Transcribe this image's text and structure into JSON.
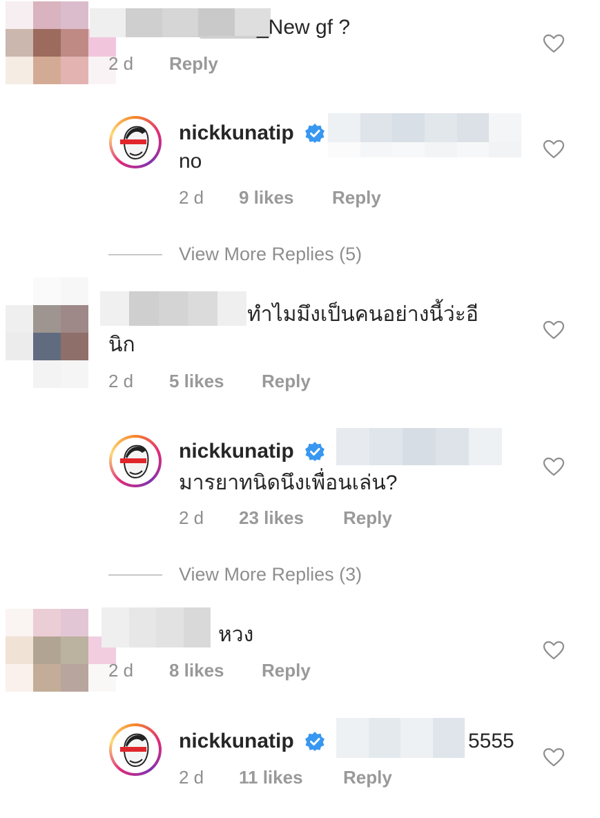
{
  "comments": [
    {
      "text": "_New gf ?",
      "time": "2 d",
      "reply_label": "Reply"
    },
    {
      "text": "ทำไมมึงเป็นคนอย่างนี้ว่ะอี",
      "text_line2": "นิก",
      "time": "2 d",
      "likes": "5 likes",
      "reply_label": "Reply"
    },
    {
      "text": "หวง",
      "time": "2 d",
      "likes": "8 likes",
      "reply_label": "Reply"
    }
  ],
  "replies": [
    {
      "username": "nickkunatip",
      "text": "no",
      "time": "2 d",
      "likes": "9 likes",
      "reply_label": "Reply"
    },
    {
      "username": "nickkunatip",
      "text": "มารยาทนิดนึงเพื่อนเล่น?",
      "time": "2 d",
      "likes": "23 likes",
      "reply_label": "Reply"
    },
    {
      "username": "nickkunatip",
      "text": "5555",
      "time": "2 d",
      "likes": "11 likes",
      "reply_label": "Reply"
    }
  ],
  "view_more": [
    {
      "label": "View More Replies (5)"
    },
    {
      "label": "View More Replies (3)"
    }
  ],
  "icons": {
    "heart": "heart-outline-icon",
    "verified": "verified-badge-icon"
  },
  "colors": {
    "verified_blue": "#3897f0",
    "meta_gray": "#8e8e8e",
    "text": "#262626"
  }
}
